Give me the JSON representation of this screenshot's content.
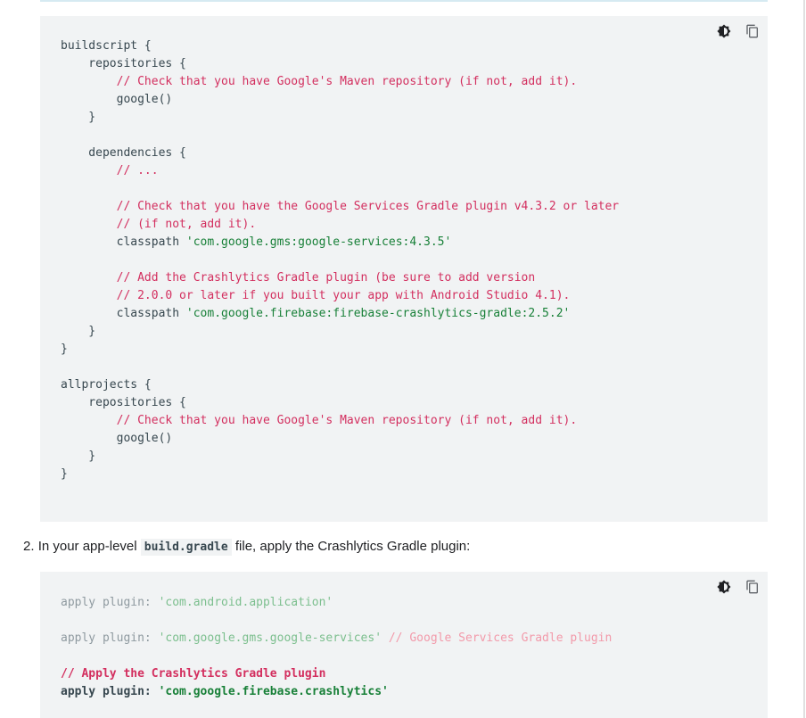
{
  "icons": {
    "theme_toggle": "brightness-contrast-icon",
    "copy": "copy-icon"
  },
  "block1": {
    "lines": [
      {
        "t": "buildscript {"
      },
      {
        "t": "    repositories {"
      },
      {
        "t": "        // Check that you have Google's Maven repository (if not, add it).",
        "k": "c"
      },
      {
        "t": "        google()"
      },
      {
        "t": "    }"
      },
      {
        "t": ""
      },
      {
        "t": "    dependencies {"
      },
      {
        "t": "        // ...",
        "k": "c"
      },
      {
        "t": ""
      },
      {
        "t": "        // Check that you have the Google Services Gradle plugin v4.3.2 or later",
        "k": "c"
      },
      {
        "t": "        // (if not, add it).",
        "k": "c"
      },
      {
        "t": "        classpath ",
        "s": "'com.google.gms:google-services:4.3.5'"
      },
      {
        "t": ""
      },
      {
        "t": "        // Add the Crashlytics Gradle plugin (be sure to add version",
        "k": "c"
      },
      {
        "t": "        // 2.0.0 or later if you built your app with Android Studio 4.1).",
        "k": "c"
      },
      {
        "t": "        classpath ",
        "s": "'com.google.firebase:firebase-crashlytics-gradle:2.5.2'"
      },
      {
        "t": "    }"
      },
      {
        "t": "}"
      },
      {
        "t": ""
      },
      {
        "t": "allprojects {"
      },
      {
        "t": "    repositories {"
      },
      {
        "t": "        // Check that you have Google's Maven repository (if not, add it).",
        "k": "c"
      },
      {
        "t": "        google()"
      },
      {
        "t": "    }"
      },
      {
        "t": "}"
      }
    ]
  },
  "step2": {
    "number": "2.",
    "text_before": "In your app-level",
    "code": "build.gradle",
    "text_after": "file, apply the Crashlytics Gradle plugin:"
  },
  "block2": {
    "lines": [
      {
        "t": "apply plugin: ",
        "s": "'com.android.application'",
        "dim": true
      },
      {
        "t": ""
      },
      {
        "t": "apply plugin: ",
        "s": "'com.google.gms.google-services'",
        "c": " // Google Services Gradle plugin",
        "dim": true
      },
      {
        "t": ""
      },
      {
        "c": "// Apply the Crashlytics Gradle plugin",
        "bold": true
      },
      {
        "t": "apply plugin: ",
        "s": "'com.google.firebase.crashlytics'",
        "bold": true
      }
    ]
  }
}
